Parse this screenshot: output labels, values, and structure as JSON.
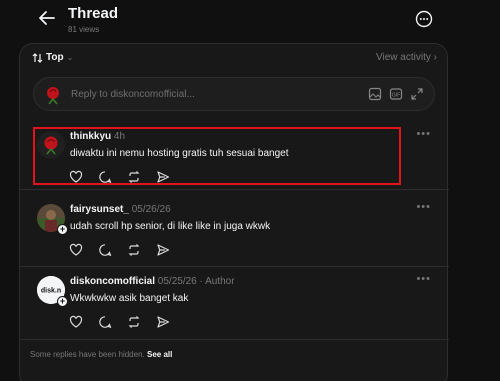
{
  "header": {
    "title": "Thread",
    "views": "81 views"
  },
  "sort": {
    "label": "Top",
    "view_activity": "View activity"
  },
  "reply_box": {
    "placeholder": "Reply to diskoncomofficial..."
  },
  "replies": [
    {
      "username": "thinkkyu",
      "time": "4h",
      "author_tag": "",
      "text": "diwaktu ini nemu hosting gratis tuh sesuai banget"
    },
    {
      "username": "fairysunset_",
      "time": "05/26/26",
      "author_tag": "",
      "text": "udah scroll hp senior, di like like in juga wkwk"
    },
    {
      "username": "diskoncomofficial",
      "time": "05/25/26",
      "author_tag": "Author",
      "text": "Wkwkwkw asik banget kak",
      "avatar_text": "disk.n"
    }
  ],
  "footer": {
    "hidden_text": "Some replies have been hidden.",
    "see_all": "See all"
  },
  "colors": {
    "background": "#101010",
    "panel": "#181818",
    "highlight": "#e3121d"
  },
  "icons": [
    "back-arrow-icon",
    "more-circle-icon",
    "chevron-down-icon",
    "chevron-right-icon",
    "image-icon",
    "gif-icon",
    "expand-icon",
    "heart-icon",
    "comment-icon",
    "repost-icon",
    "share-icon",
    "more-dots-icon",
    "plus-icon"
  ]
}
